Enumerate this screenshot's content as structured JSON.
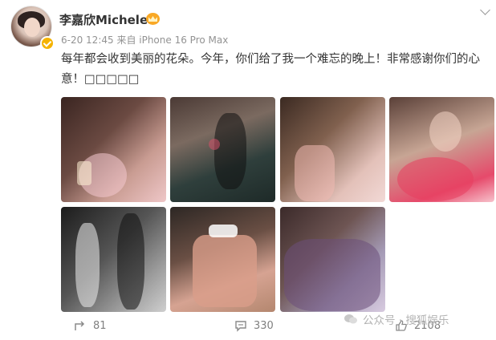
{
  "user": {
    "name": "李嘉欣Michele",
    "meta": "6-20 12:45  来自 iPhone 16 Pro Max"
  },
  "post": {
    "text": "每年都会收到美丽的花朵。今年，你们给了我一个难忘的晚上！非常感谢你们的心意！□□□□□"
  },
  "photos": [
    {
      "name": "photo-birthday-cake-pink-dress"
    },
    {
      "name": "photo-seated-black-dress"
    },
    {
      "name": "photo-cake-with-flowers"
    },
    {
      "name": "photo-closeup-with-roses"
    },
    {
      "name": "photo-bw-with-child"
    },
    {
      "name": "photo-butterfly-cake"
    },
    {
      "name": "photo-group-family"
    }
  ],
  "actions": {
    "repost_count": "81",
    "comment_count": "330",
    "like_count": "2108"
  },
  "watermark": {
    "text": "公众号 · 搜狐娱乐"
  },
  "colors": {
    "verified_badge": "#f5b300",
    "crown": "#f9a825",
    "meta_text": "#939393"
  }
}
